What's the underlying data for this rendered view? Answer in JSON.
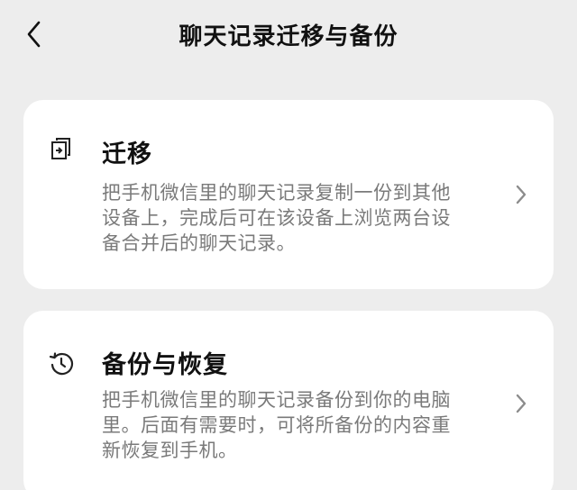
{
  "header": {
    "title": "聊天记录迁移与备份",
    "back_icon": "chevron-left-icon"
  },
  "cards": [
    {
      "title": "迁移",
      "description": "把手机微信里的聊天记录复制一份到其他设备上，完成后可在该设备上浏览两台设备合并后的聊天记录。",
      "icon": "migrate-icon",
      "chevron_icon": "chevron-right-icon"
    },
    {
      "title": "备份与恢复",
      "description": "把手机微信里的聊天记录备份到你的电脑里。后面有需要时，可将所备份的内容重新恢复到手机。",
      "icon": "history-icon",
      "chevron_icon": "chevron-right-icon"
    }
  ],
  "colors": {
    "background": "#ededed",
    "card": "#ffffff",
    "title_text": "#111111",
    "description_text": "#7a7a7a",
    "chevron": "#8c8c8c"
  }
}
